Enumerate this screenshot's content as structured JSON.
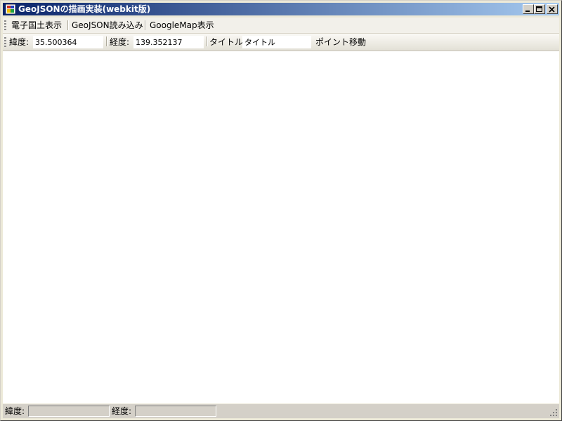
{
  "window": {
    "title": "GeoJSONの描画実装(webkit版)",
    "controls": {
      "minimize": "minimize-icon",
      "maximize": "maximize-icon",
      "close": "close-icon"
    }
  },
  "menu": {
    "items": [
      {
        "label": "電子国土表示"
      },
      {
        "label": "GeoJSON読み込み"
      },
      {
        "label": "GoogleMap表示"
      }
    ]
  },
  "toolbar": {
    "lat_label": "緯度:",
    "lat_value": "35.500364",
    "lon_label": "経度:",
    "lon_value": "139.352137",
    "title_label": "タイトル:",
    "title_value": "タイトル",
    "move_button": "ポイント移動"
  },
  "statusbar": {
    "lat_label": "緯度:",
    "lat_value": "",
    "lon_label": "経度:",
    "lon_value": ""
  }
}
